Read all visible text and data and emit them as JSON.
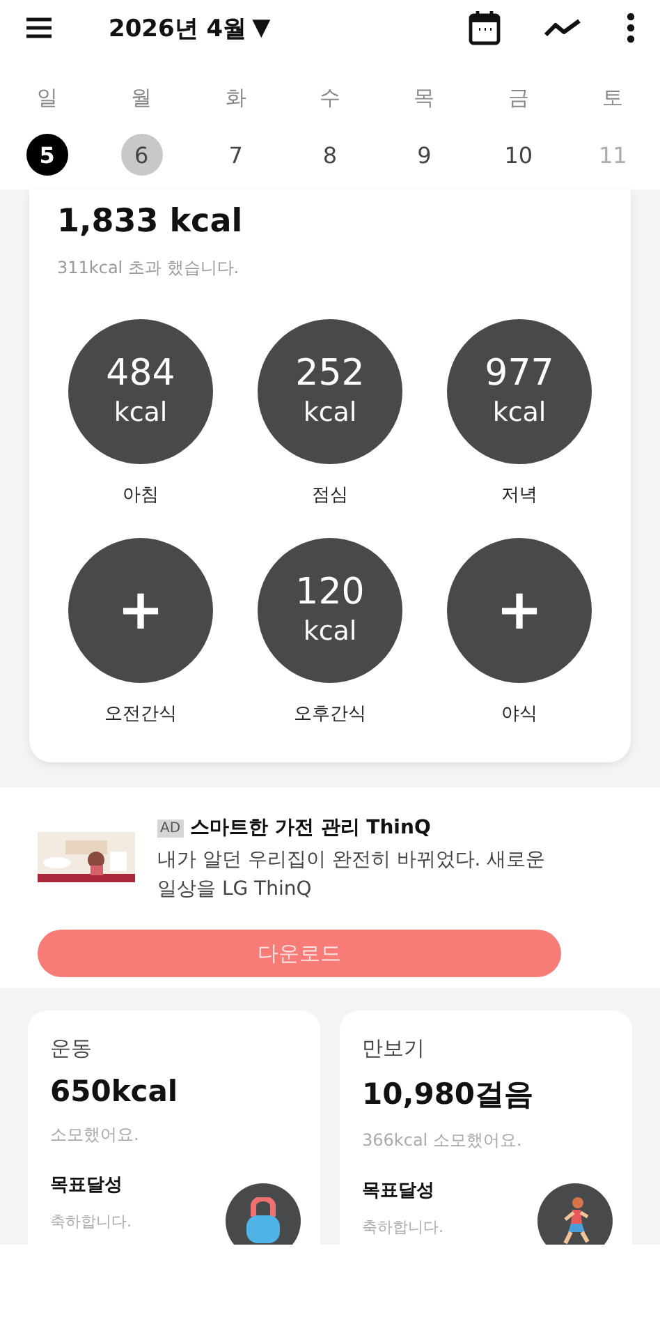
{
  "header": {
    "title": "2026년 4월",
    "dropdown": "▼"
  },
  "weekdays": [
    "일",
    "월",
    "화",
    "수",
    "목",
    "금",
    "토"
  ],
  "days": [
    {
      "label": "5",
      "selected": true,
      "today": false,
      "muted": false
    },
    {
      "label": "6",
      "selected": false,
      "today": true,
      "muted": false
    },
    {
      "label": "7",
      "selected": false,
      "today": false,
      "muted": false
    },
    {
      "label": "8",
      "selected": false,
      "today": false,
      "muted": false
    },
    {
      "label": "9",
      "selected": false,
      "today": false,
      "muted": false
    },
    {
      "label": "10",
      "selected": false,
      "today": false,
      "muted": false
    },
    {
      "label": "11",
      "selected": false,
      "today": false,
      "muted": true
    }
  ],
  "intake": {
    "total": "1,833 kcal",
    "note": "311kcal 초과 했습니다.",
    "meals": [
      {
        "kind": "value",
        "value": "484",
        "unit": "kcal",
        "label": "아침"
      },
      {
        "kind": "value",
        "value": "252",
        "unit": "kcal",
        "label": "점심"
      },
      {
        "kind": "value",
        "value": "977",
        "unit": "kcal",
        "label": "저녁"
      },
      {
        "kind": "add",
        "symbol": "+",
        "label": "오전간식"
      },
      {
        "kind": "value",
        "value": "120",
        "unit": "kcal",
        "label": "오후간식"
      },
      {
        "kind": "add",
        "symbol": "+",
        "label": "야식"
      }
    ]
  },
  "ad": {
    "badge": "AD",
    "title": "스마트한 가전 관리 ThinQ",
    "body": "내가 알던 우리집이 완전히 바뀌었다. 새로운 일상을 LG ThinQ",
    "button": "다운로드"
  },
  "activity": [
    {
      "kind": "exercise",
      "title": "운동",
      "value": "650kcal",
      "note": "소모했어요.",
      "goal": "목표달성",
      "goal_note": "축하합니다."
    },
    {
      "kind": "steps",
      "title": "만보기",
      "value": "10,980걸음",
      "note": "366kcal 소모했어요.",
      "goal": "목표달성",
      "goal_note": "축하합니다."
    }
  ]
}
